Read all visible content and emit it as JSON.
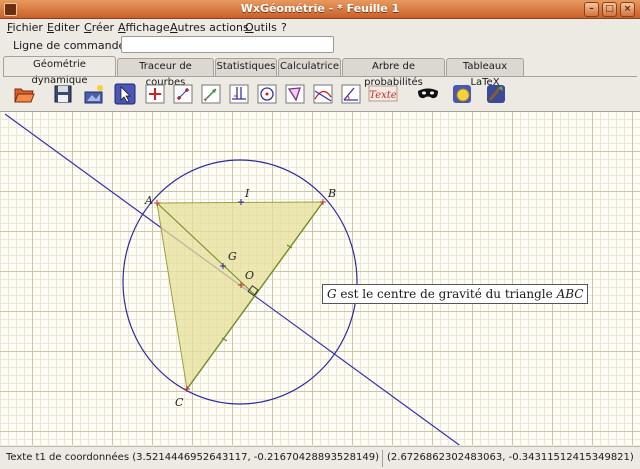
{
  "window": {
    "title": "WxGéométrie - * Feuille 1"
  },
  "menu": [
    "Fichier",
    "Editer",
    "Créer",
    "Affichage",
    "Autres actions",
    "Outils",
    "?"
  ],
  "command": {
    "label": "Ligne de commande :",
    "value": ""
  },
  "tabs": [
    "Géométrie dynamique",
    "Traceur de courbes",
    "Statistiques",
    "Calculatrice",
    "Arbre de probabilités",
    "Tableaux LaTeX"
  ],
  "active_tab": "Géométrie dynamique",
  "toolbar": [
    "folder-open-icon",
    "floppy-save-icon",
    "image-export-icon",
    "cursor-arrow-icon",
    "point-icon",
    "points-icon",
    "vector-icon",
    "perpendicular-icon",
    "circle-icon",
    "polygon-icon",
    "curve-intersection-icon",
    "angle-icon",
    "text-tool-icon",
    "mask-icon",
    "color-fill-icon",
    "brush-icon"
  ],
  "toolbar_text_label": "Texte",
  "figure": {
    "points": {
      "A": "A",
      "B": "B",
      "C": "C",
      "I": "I",
      "G": "G",
      "O": "O"
    },
    "text_box": {
      "g": "G",
      "middle": " est le centre de gravité du triangle ",
      "abc": "ABC"
    },
    "colors": {
      "circle": "#2a2aa0",
      "line": "#3333b0",
      "triangle_fill": "#e6df9a",
      "triangle_stroke": "#9aa040",
      "segment": "#6a8a20",
      "point": "#c0302a"
    }
  },
  "status": {
    "left": "Texte t1 de coordonnées (3.52144469526431​17, -0.21670428893528149)",
    "right": "(2.6726862302483063, -0.34311512415349821)"
  }
}
